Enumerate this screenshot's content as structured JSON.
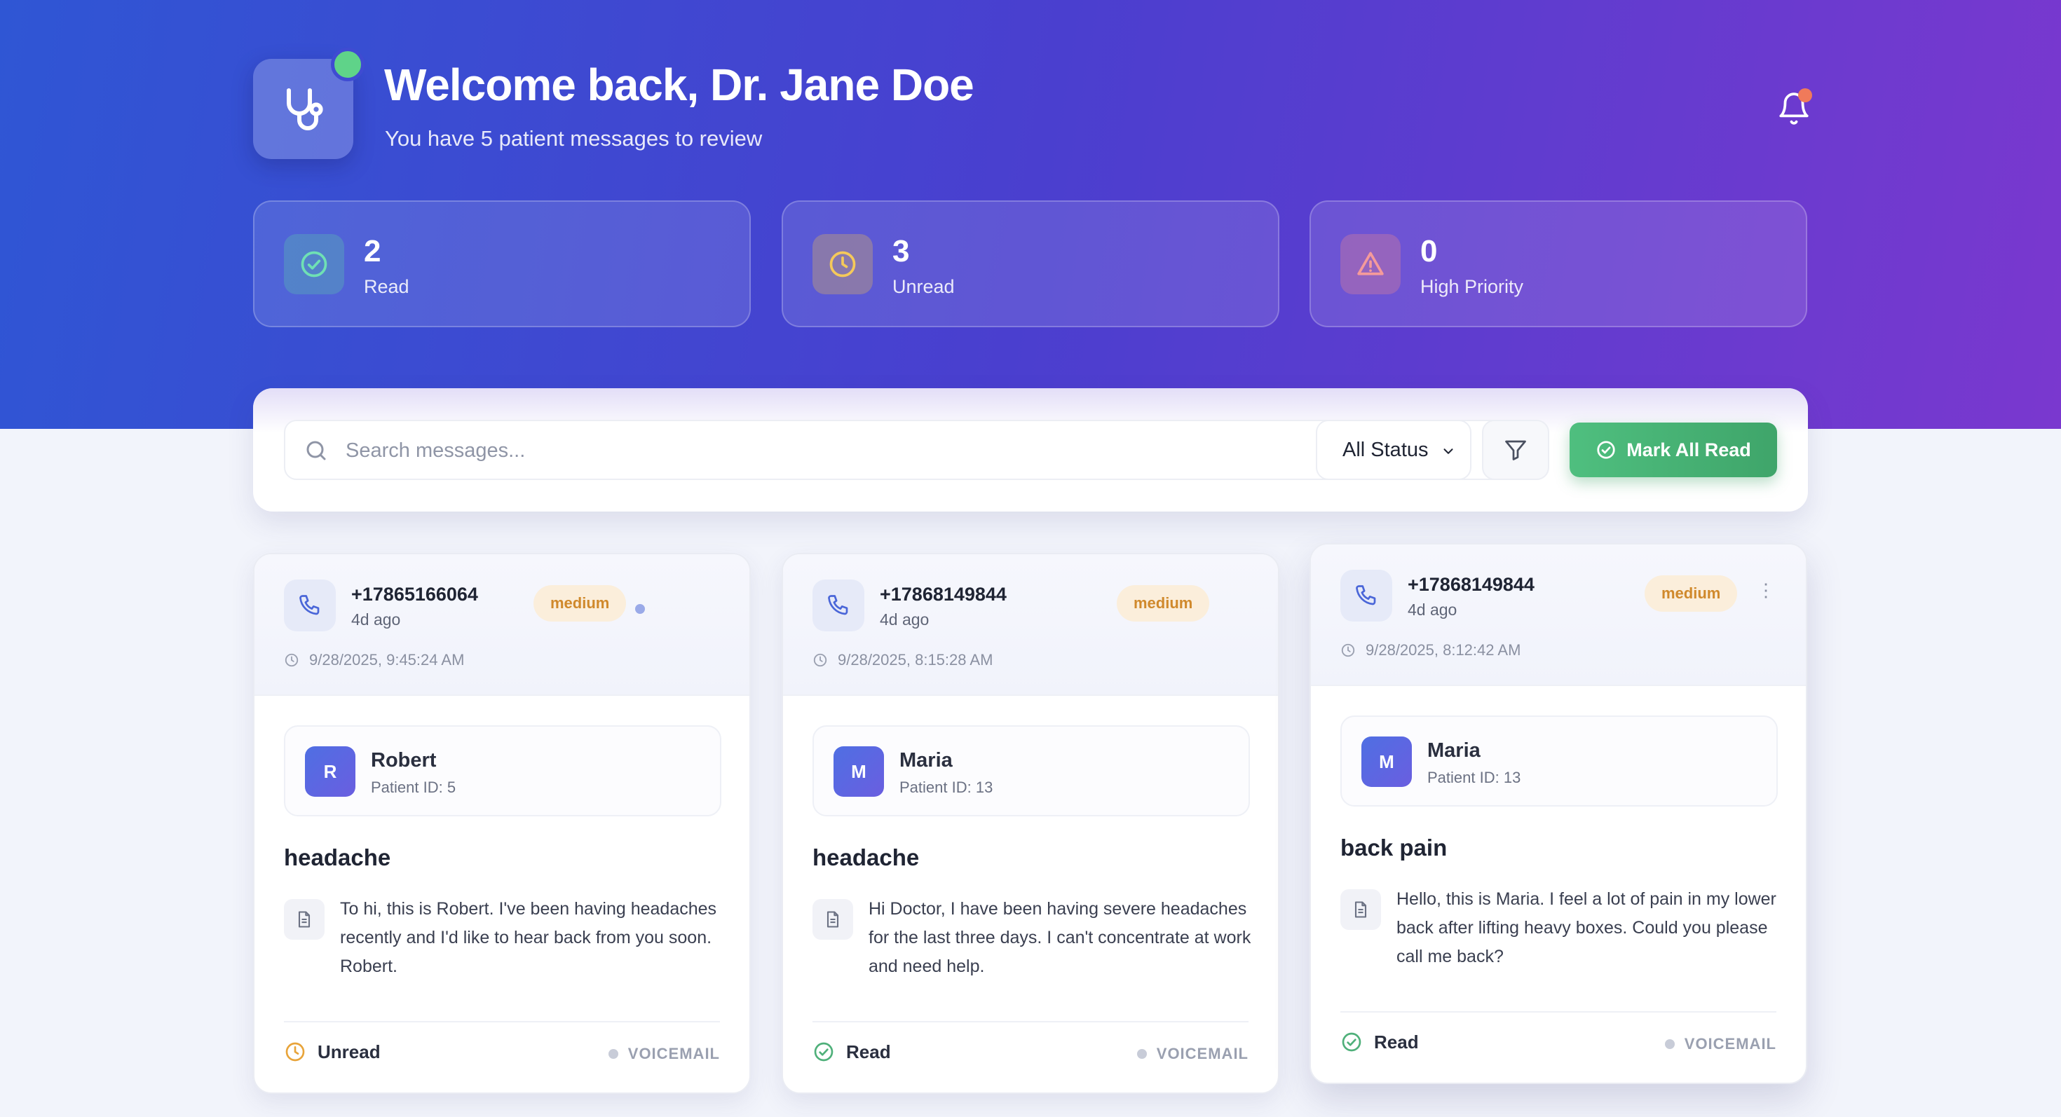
{
  "header": {
    "title": "Welcome back, Dr. Jane Doe",
    "subtitle": "You have 5 patient messages to review"
  },
  "stats": [
    {
      "value": "2",
      "label": "Read",
      "icon": "check-circle-icon",
      "color": "#5fd3a6"
    },
    {
      "value": "3",
      "label": "Unread",
      "icon": "clock-icon",
      "color": "#f2c14e"
    },
    {
      "value": "0",
      "label": "High Priority",
      "icon": "warning-icon",
      "color": "#f28c8c"
    }
  ],
  "toolbar": {
    "search_placeholder": "Search messages...",
    "status_filter": "All Status",
    "mark_all_label": "Mark All Read"
  },
  "messages": [
    {
      "phone": "+17865166064",
      "ago": "4d ago",
      "priority": "medium",
      "timestamp": "9/28/2025, 9:45:24 AM",
      "avatar": "R",
      "patient_name": "Robert",
      "patient_id": "Patient ID: 5",
      "subject": "headache",
      "body": "To hi, this is Robert. I've been having headaches recently and I'd like to hear back from you soon. Robert.",
      "status": "Unread",
      "type": "VOICEMAIL"
    },
    {
      "phone": "+17868149844",
      "ago": "4d ago",
      "priority": "medium",
      "timestamp": "9/28/2025, 8:15:28 AM",
      "avatar": "M",
      "patient_name": "Maria",
      "patient_id": "Patient ID: 13",
      "subject": "headache",
      "body": "Hi Doctor, I have been having severe headaches for the last three days. I can't concentrate at work and need help.",
      "status": "Read",
      "type": "VOICEMAIL"
    },
    {
      "phone": "+17868149844",
      "ago": "4d ago",
      "priority": "medium",
      "timestamp": "9/28/2025, 8:12:42 AM",
      "avatar": "M",
      "patient_name": "Maria",
      "patient_id": "Patient ID: 13",
      "subject": "back pain",
      "body": "Hello, this is Maria. I feel a lot of pain in my lower back after lifting heavy boxes. Could you please call me back?",
      "status": "Read",
      "type": "VOICEMAIL"
    }
  ],
  "colors": {
    "hero_start": "#2f56d4",
    "hero_end": "#7a38cf",
    "read_green": "#4fb07a",
    "unread_amber": "#e8a43a",
    "priority_badge_bg": "#fbeedb",
    "priority_badge_text": "#d0892c"
  }
}
